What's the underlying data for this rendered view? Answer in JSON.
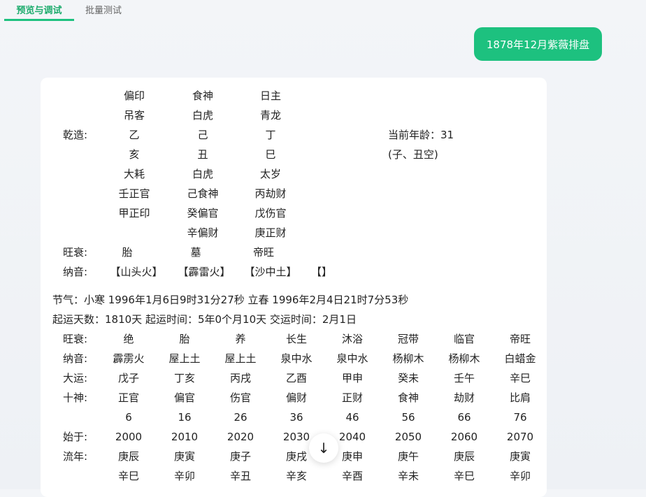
{
  "tabs": [
    "预览与调试",
    "批量测试"
  ],
  "user_message": "1878年12月紫薇排盘",
  "chart": {
    "label_qianzao": "乾造:",
    "label_wangshuai": "旺衰:",
    "label_nayin": "纳音:",
    "columns": [
      {
        "shishen": "偏印",
        "shensha1": "吊客",
        "gan": "乙",
        "zhi": "亥",
        "shensha2": "大耗",
        "canggan": [
          "壬正官",
          "甲正印"
        ],
        "wangshuai": "胎",
        "nayin": "【山头火】"
      },
      {
        "shishen": "食神",
        "shensha1": "白虎",
        "gan": "己",
        "zhi": "丑",
        "shensha2": "白虎",
        "canggan": [
          "己食神",
          "癸偏官",
          "辛偏财"
        ],
        "wangshuai": "墓",
        "nayin": "【霹雷火】"
      },
      {
        "shishen": "日主",
        "shensha1": "青龙",
        "gan": "丁",
        "zhi": "巳",
        "shensha2": "太岁",
        "canggan": [
          "丙劫财",
          "戊伤官",
          "庚正财"
        ],
        "wangshuai": "帝旺",
        "nayin": "【沙中土】"
      },
      {
        "nayin": "【】"
      }
    ],
    "age": "当前年龄：31",
    "kongwang": "(子、丑空)"
  },
  "jieqi": "节气：小寒 1996年1月6日9时31分27秒 立春 1996年2月4日21时7分53秒",
  "qiyun": "起运天数：1810天 起运时间：5年0个月10天 交运时间：2月1日",
  "dayun": {
    "rows": [
      {
        "label": "旺衰:",
        "values": [
          "绝",
          "胎",
          "养",
          "长生",
          "沐浴",
          "冠带",
          "临官",
          "帝旺"
        ]
      },
      {
        "label": "纳音:",
        "values": [
          "霹雳火",
          "屋上土",
          "屋上土",
          "泉中水",
          "泉中水",
          "杨柳木",
          "杨柳木",
          "白蜡金"
        ]
      },
      {
        "label": "大运:",
        "values": [
          "戊子",
          "丁亥",
          "丙戌",
          "乙酉",
          "甲申",
          "癸未",
          "壬午",
          "辛巳"
        ]
      },
      {
        "label": "十神:",
        "values": [
          "正官",
          "偏官",
          "伤官",
          "偏财",
          "正财",
          "食神",
          "劫财",
          "比肩"
        ]
      },
      {
        "label": "",
        "values": [
          "6",
          "16",
          "26",
          "36",
          "46",
          "56",
          "66",
          "76"
        ]
      },
      {
        "label": "始于:",
        "values": [
          "2000",
          "2010",
          "2020",
          "2030",
          "2040",
          "2050",
          "2060",
          "2070"
        ]
      },
      {
        "label": "流年:",
        "values": [
          "庚辰",
          "庚寅",
          "庚子",
          "庚戌",
          "庚申",
          "庚午",
          "庚辰",
          "庚寅"
        ]
      },
      {
        "label": "",
        "values": [
          "辛巳",
          "辛卯",
          "辛丑",
          "辛亥",
          "辛酉",
          "辛未",
          "辛巳",
          "辛卯"
        ]
      }
    ]
  },
  "scroll_button_icon": "arrow-down-icon"
}
